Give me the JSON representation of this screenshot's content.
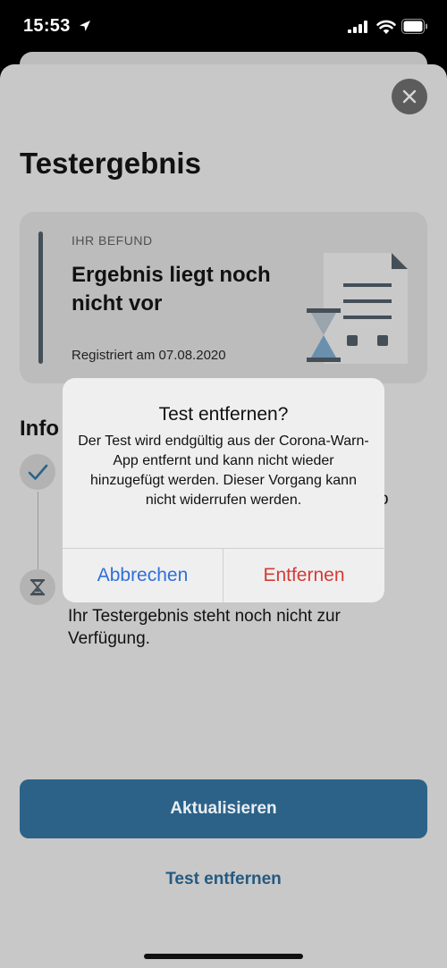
{
  "status_bar": {
    "time": "15:53",
    "icons": [
      "location-arrow-icon",
      "cellular-signal-icon",
      "wifi-icon",
      "battery-icon"
    ]
  },
  "screen": {
    "title": "Testergebnis",
    "close_icon": "close-icon"
  },
  "result_card": {
    "label": "IHR BEFUND",
    "result": "Ergebnis liegt noch nicht vor",
    "registered": "Registriert am 07.08.2020",
    "illustration": "document-hourglass-illustration"
  },
  "info": {
    "heading_partial": "Info",
    "steps": [
      {
        "icon": "checkmark-icon",
        "state": "done",
        "clipped_text": "o"
      },
      {
        "icon": "hourglass-icon",
        "state": "pending",
        "text": "Ihr Testergebnis steht noch nicht zur Verfügung."
      }
    ]
  },
  "buttons": {
    "primary": "Aktualisieren",
    "link": "Test entfernen"
  },
  "alert": {
    "title": "Test entfernen?",
    "message": "Der Test wird endgültig aus der Corona-Warn-App entfernt und kann nicht wieder hinzugefügt werden. Dieser Vorgang kann nicht widerrufen werden.",
    "cancel": "Abbrechen",
    "confirm": "Entfernen"
  },
  "colors": {
    "primary": "#2c6288",
    "link": "#245a80",
    "alert_cancel": "#2f6fd9",
    "alert_destructive": "#d43b37"
  }
}
